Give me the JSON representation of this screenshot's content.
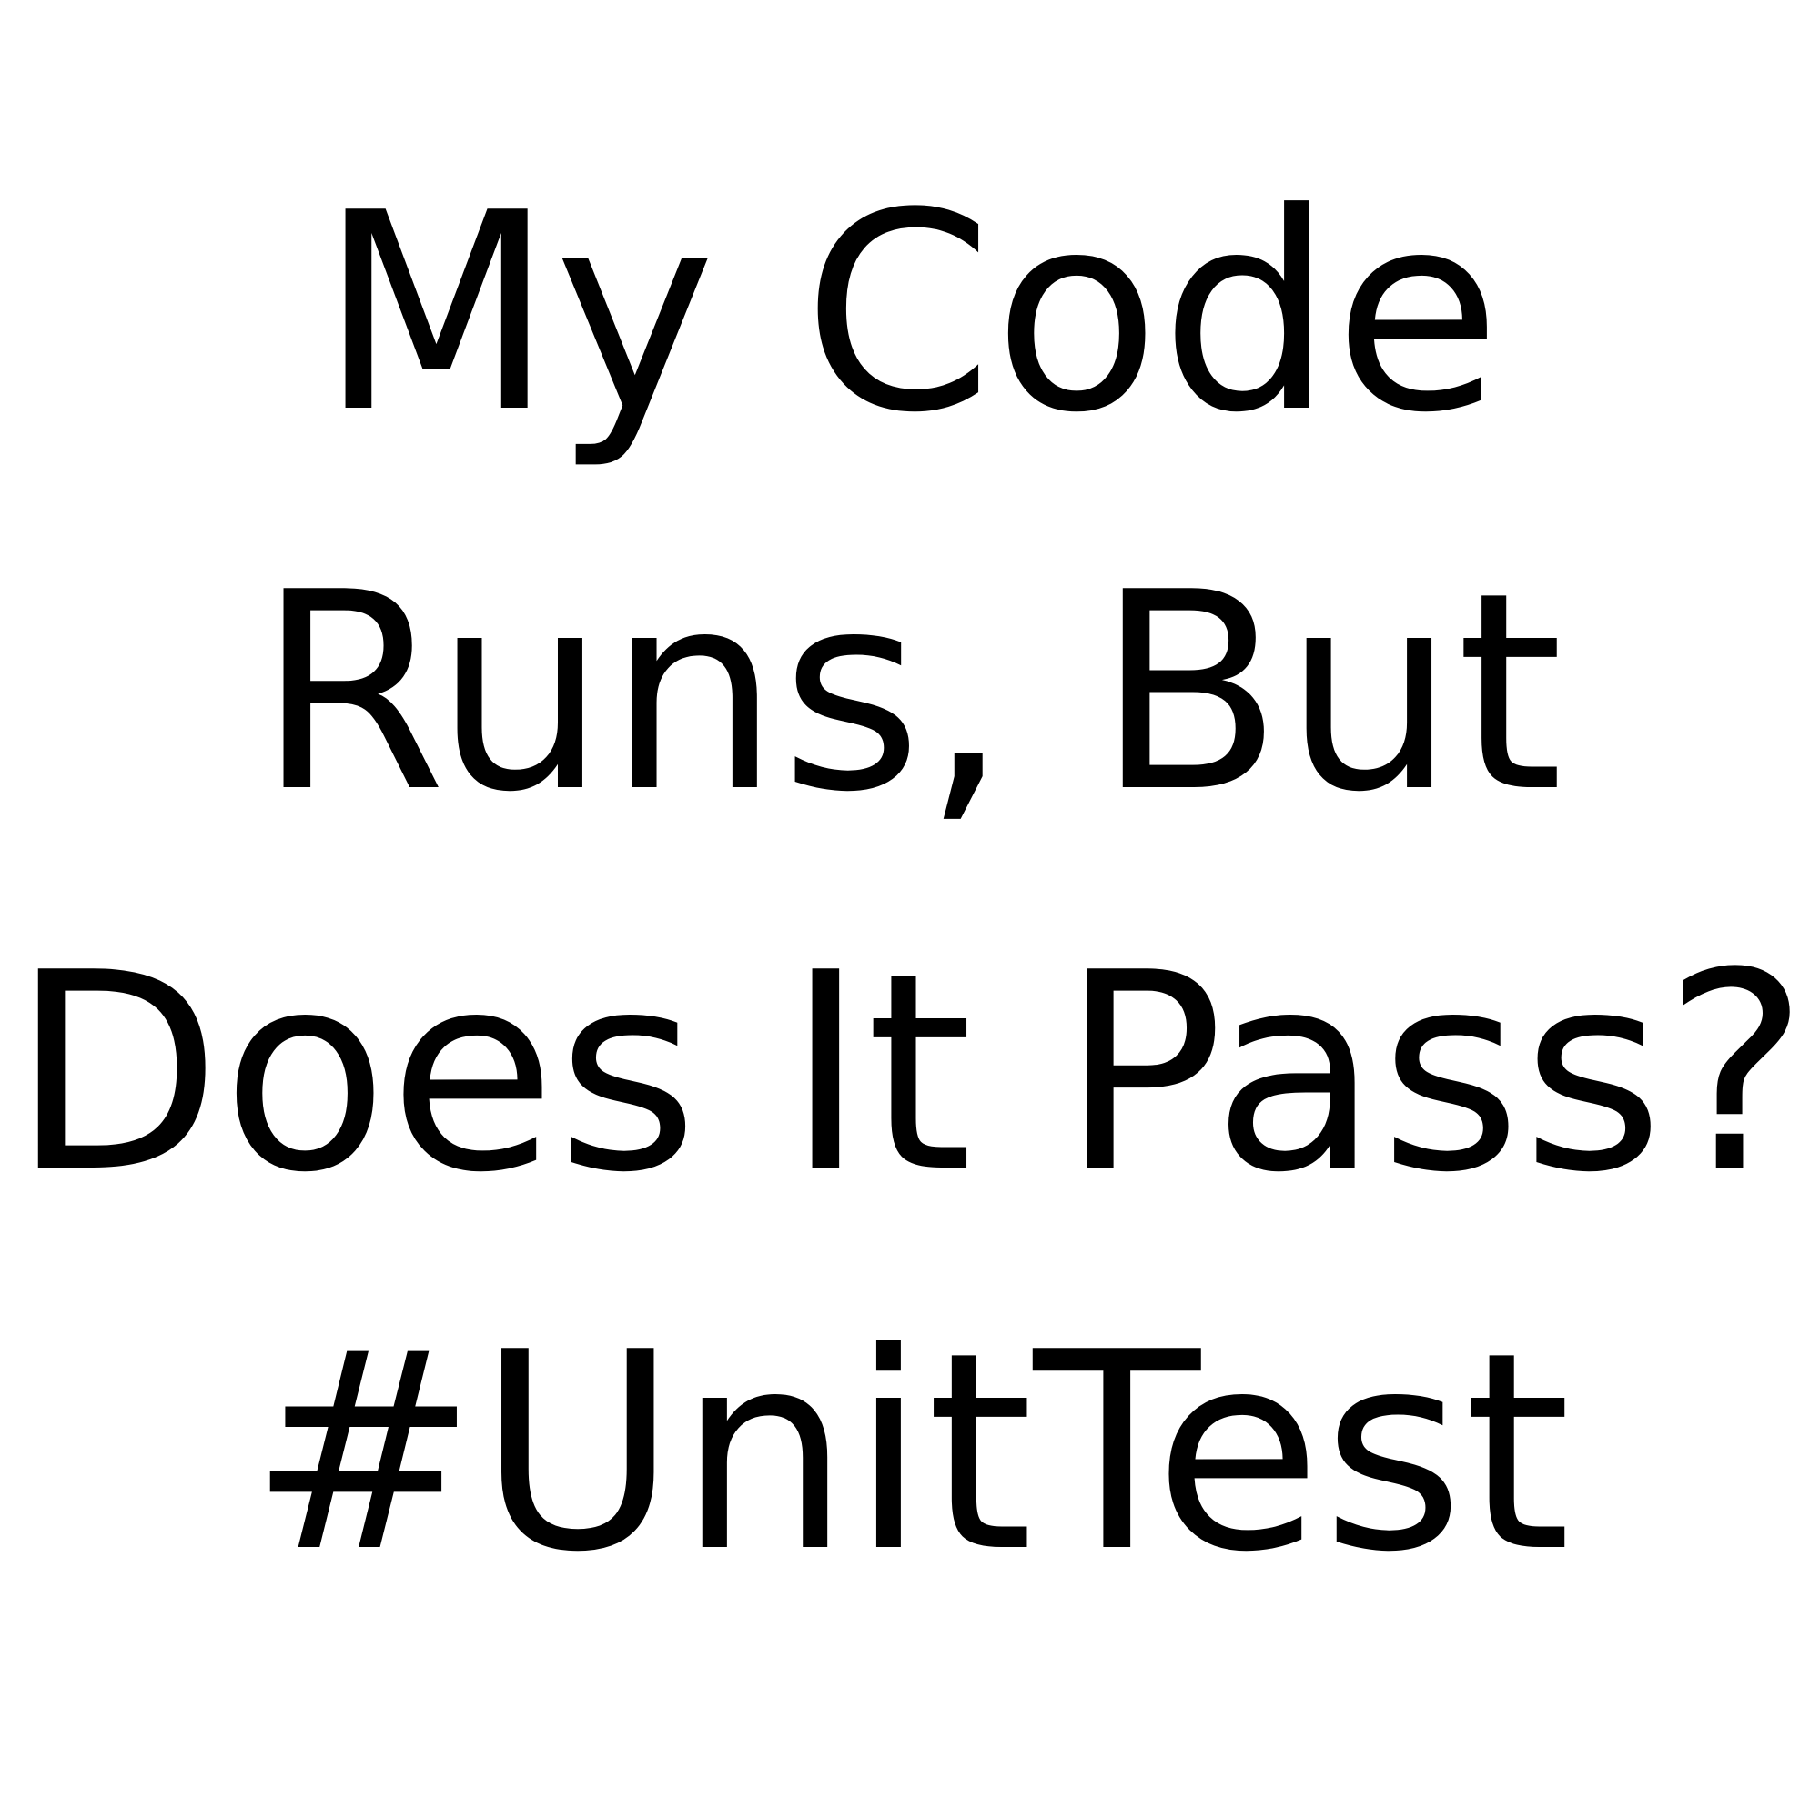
{
  "caption": {
    "lines": [
      "My Code",
      "Runs, But",
      "Does It Pass?",
      "#UnitTest"
    ]
  },
  "colors": {
    "background": "#ffffff",
    "text": "#000000"
  }
}
